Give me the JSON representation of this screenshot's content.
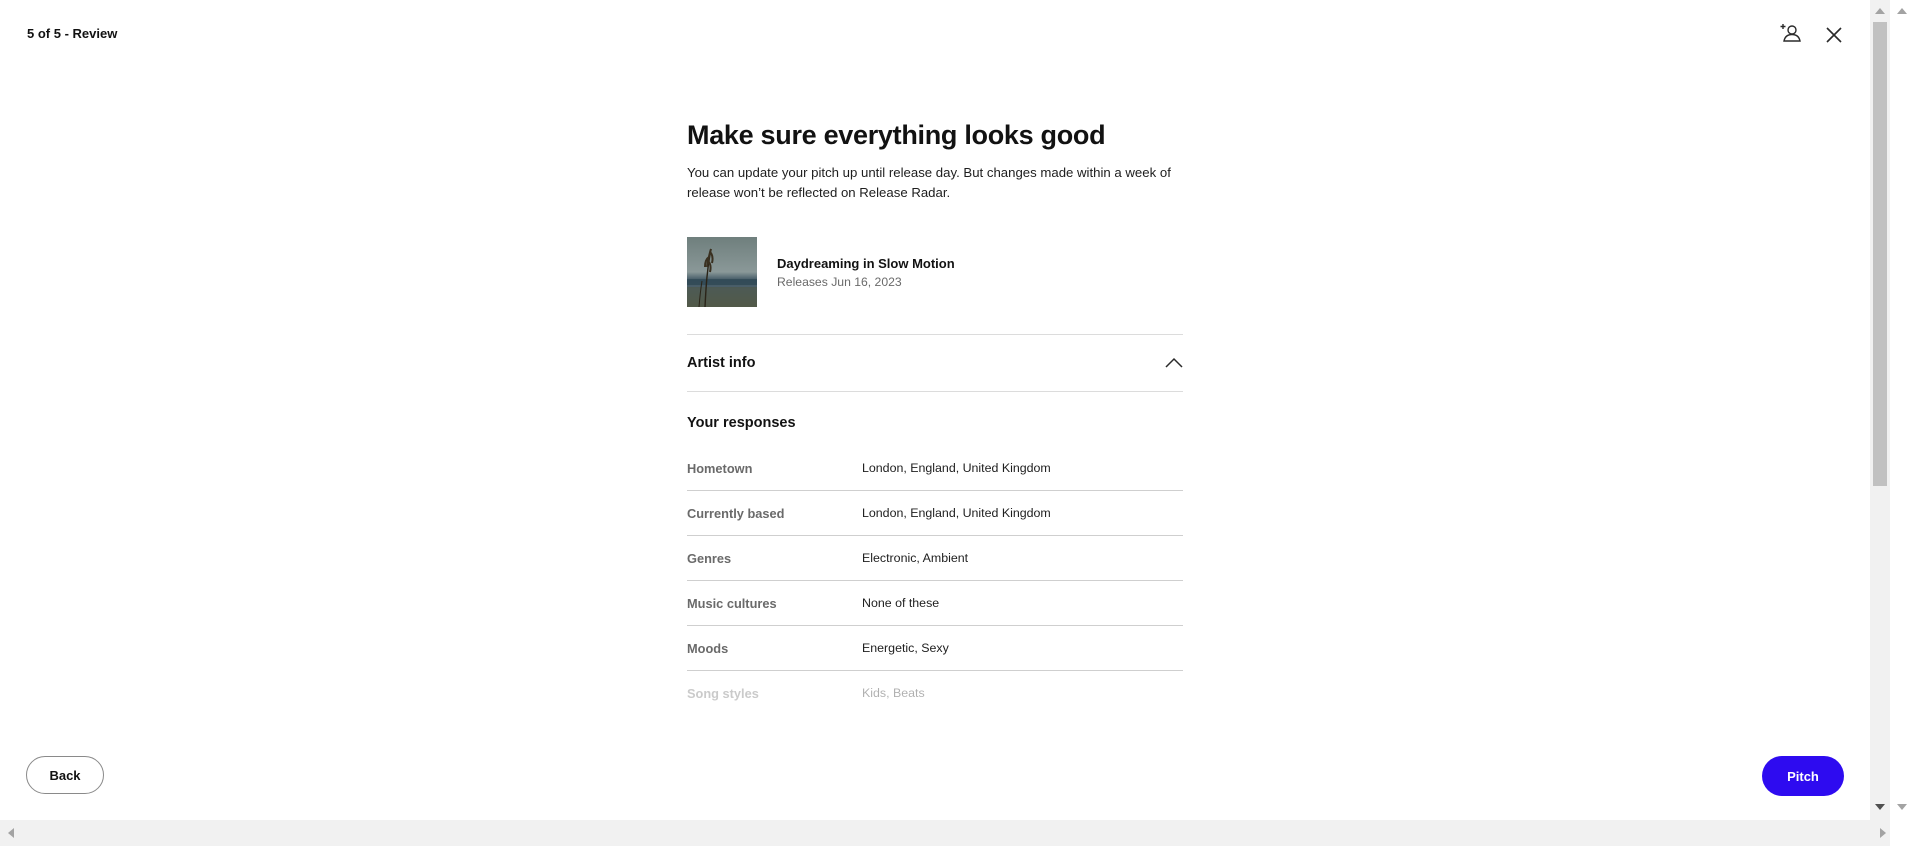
{
  "header": {
    "step_label": "5 of 5 - Review",
    "invite_icon": "add-person-icon",
    "close_icon": "close-icon"
  },
  "main": {
    "title": "Make sure everything looks good",
    "subtitle": "You can update your pitch up until release day. But changes made within a week of release won’t be reflected on Release Radar.",
    "release": {
      "title": "Daydreaming in Slow Motion",
      "date_text": "Releases Jun 16, 2023"
    },
    "accordion": {
      "label": "Artist info",
      "state": "expanded",
      "icon": "chevron-up-icon"
    },
    "responses": {
      "heading": "Your responses",
      "rows": [
        {
          "key": "Hometown",
          "value": "London, England, United Kingdom"
        },
        {
          "key": "Currently based",
          "value": "London, England, United Kingdom"
        },
        {
          "key": "Genres",
          "value": "Electronic, Ambient"
        },
        {
          "key": "Music cultures",
          "value": "None of these"
        },
        {
          "key": "Moods",
          "value": "Energetic, Sexy"
        },
        {
          "key": "Song styles",
          "value": "Kids, Beats"
        }
      ]
    }
  },
  "footer": {
    "back_label": "Back",
    "pitch_label": "Pitch"
  },
  "colors": {
    "accent": "#2e0bf0",
    "text": "#121212",
    "muted": "#6a6a6a",
    "divider": "#dcdcdc"
  }
}
